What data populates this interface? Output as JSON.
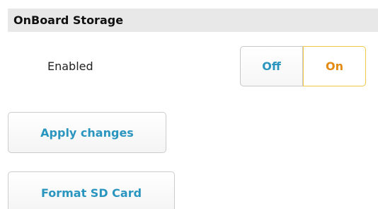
{
  "section": {
    "title": "OnBoard Storage"
  },
  "setting": {
    "label": "Enabled",
    "toggle": {
      "off_label": "Off",
      "on_label": "On",
      "selected": "On"
    }
  },
  "actions": {
    "apply_label": "Apply changes",
    "format_label": "Format SD Card"
  },
  "colors": {
    "accent_blue": "#2a95bf",
    "accent_orange": "#e38a12",
    "selected_border": "#f1c94a",
    "header_bg": "#e8e8e8"
  }
}
